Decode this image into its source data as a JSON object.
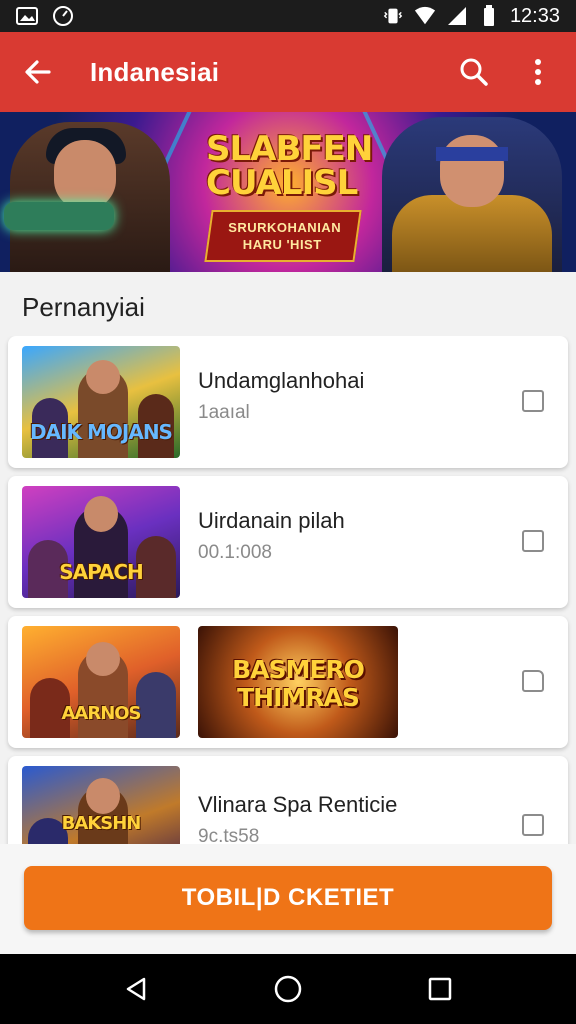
{
  "status_bar": {
    "time": "12:33",
    "icons": [
      "image-icon",
      "compass-icon",
      "vibrate-icon",
      "wifi-icon",
      "signal-icon",
      "battery-icon"
    ]
  },
  "app_bar": {
    "title": "Indanesiai",
    "icons": [
      "back-arrow-icon",
      "search-icon",
      "more-vert-icon"
    ]
  },
  "banner": {
    "title": "SLABFEN CUALISL",
    "ribbon_line1": "SRURKOHANIAN",
    "ribbon_line2": "HARU 'HIST"
  },
  "section": {
    "title": "Pernanyiai"
  },
  "items": [
    {
      "title": "Undamglanhohai",
      "subtitle": "1aaıal",
      "thumb_text": "DAIK MOJANS",
      "checked": false
    },
    {
      "title": "Uirdanain pilah",
      "subtitle": "00.1:008",
      "thumb_text": "SAPACH",
      "checked": false
    },
    {
      "title": "BASMERO THIMRAS",
      "subtitle": "",
      "thumb_text": "AARNOS",
      "checked": false
    },
    {
      "title": "Vlinara Spa Renticie",
      "subtitle": "9c.ts58",
      "thumb_text": "BAKSHN",
      "checked": false
    }
  ],
  "cta": {
    "label": "TOBIL|D CKETIET"
  },
  "nav_bar": {
    "icons": [
      "back-triangle-icon",
      "home-circle-icon",
      "recents-square-icon"
    ]
  },
  "colors": {
    "app_bar": "#d93a32",
    "cta": "#ef7417",
    "status_bar": "#1c1c1c",
    "nav_bar": "#000000"
  }
}
